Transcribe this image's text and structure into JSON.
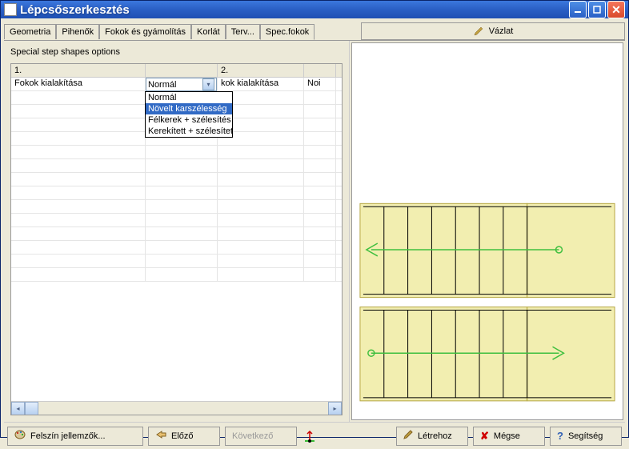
{
  "window": {
    "title": "Lépcsőszerkesztés"
  },
  "tabs": {
    "items": [
      "Geometria",
      "Pihenők",
      "Fokok és gyámolítás",
      "Korlát",
      "Terv...",
      "Spec.fokok"
    ],
    "active_index": 5
  },
  "sketch_button": {
    "label": "Vázlat"
  },
  "panel": {
    "caption": "Special step shapes options"
  },
  "grid": {
    "headers": [
      "1.",
      "",
      "2.",
      ""
    ],
    "row1": {
      "c0": "Fokok kialakítása",
      "c1": "Normál",
      "c2": "kok kialakítása",
      "c3": "Noi"
    }
  },
  "dropdown": {
    "options": [
      "Normál",
      "Növelt karszélesség",
      "Félkerek + szélesítés",
      "Kerekített + szélesített"
    ],
    "highlighted_index": 1
  },
  "buttons": {
    "surface": "Felszín jellemzők...",
    "prev": "Előző",
    "next": "Következő",
    "create": "Létrehoz",
    "cancel": "Mégse",
    "help": "Segítség"
  }
}
